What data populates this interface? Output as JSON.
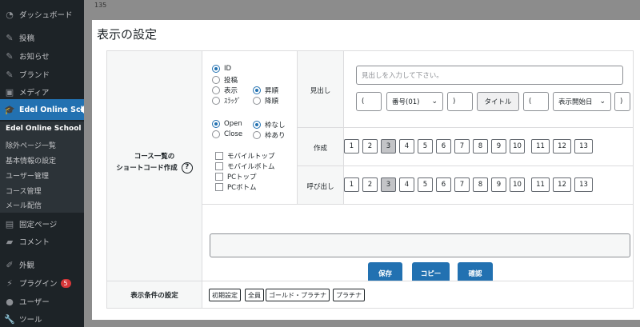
{
  "sidebar": {
    "items": [
      {
        "label": "ダッシュボード",
        "icon": "dashboard-icon"
      },
      {
        "label": "投稿",
        "icon": "pin-icon"
      },
      {
        "label": "お知らせ",
        "icon": "pin-icon"
      },
      {
        "label": "ブランド",
        "icon": "pin-icon"
      },
      {
        "label": "メディア",
        "icon": "media-icon"
      },
      {
        "label": "Edel Online School",
        "icon": "graduation-cap-icon"
      },
      {
        "label": "固定ページ",
        "icon": "page-icon"
      },
      {
        "label": "コメント",
        "icon": "comment-icon"
      },
      {
        "label": "外観",
        "icon": "brush-icon"
      },
      {
        "label": "プラグイン",
        "icon": "plugin-icon",
        "badge": "5"
      },
      {
        "label": "ユーザー",
        "icon": "user-icon"
      },
      {
        "label": "ツール",
        "icon": "wrench-icon"
      }
    ],
    "submenu": [
      "Edel Online School",
      "除外ページ一覧",
      "基本情報の設定",
      "ユーザー管理",
      "コース管理",
      "メール配信"
    ],
    "accent_color": "#2271b1"
  },
  "page_number": "135",
  "modal": {
    "title": "表示の設定",
    "shortcode_label_line1": "コース一覧の",
    "shortcode_label_line2": "ショートコード作成",
    "help": "?",
    "order_by": [
      "ID",
      "投稿",
      "表示",
      "ｽﾗｯｸﾞ"
    ],
    "sort": [
      "昇順",
      "降順"
    ],
    "status": [
      "Open",
      "Close"
    ],
    "frame": [
      "枠なし",
      "枠あり"
    ],
    "checkboxes": [
      "モバイルトップ",
      "モバイルボトム",
      "PCトップ",
      "PCボトム"
    ],
    "heading_row": {
      "label": "見出し",
      "placeholder": "見出しを入力して下さい。",
      "open_paren": "(",
      "number_select": "番号(01)",
      "close_paren": ")",
      "title_button": "タイトル",
      "open_paren2": "(",
      "date_select": "表示開始日",
      "close_paren2": ")"
    },
    "create_row": {
      "label": "作成",
      "numbers": [
        "1",
        "2",
        "3",
        "4",
        "5",
        "6",
        "7",
        "8",
        "9",
        "10",
        "11",
        "12",
        "13"
      ]
    },
    "call_row": {
      "label": "呼び出し",
      "numbers": [
        "1",
        "2",
        "3",
        "4",
        "5",
        "6",
        "7",
        "8",
        "9",
        "10",
        "11",
        "12",
        "13"
      ]
    },
    "buttons": {
      "save": "保存",
      "copy": "コピー",
      "confirm": "確認"
    },
    "condition": {
      "label": "表示条件の設定",
      "tags": [
        "初期設定",
        "全員",
        "ゴールド・プラチナ",
        "プラチナ"
      ]
    }
  }
}
